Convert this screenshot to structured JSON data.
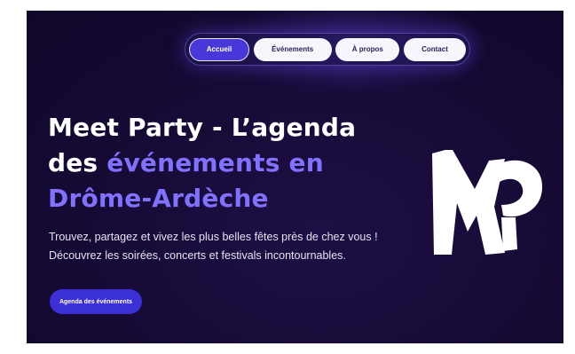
{
  "nav": {
    "items": [
      {
        "label": "Accueil",
        "active": true
      },
      {
        "label": "Événements",
        "active": false
      },
      {
        "label": "À propos",
        "active": false
      },
      {
        "label": "Contact",
        "active": false
      }
    ]
  },
  "hero": {
    "title_line1": "Meet Party - L’agenda",
    "title_line2_prefix": "des ",
    "title_line2_accent": "événements en",
    "title_line3": "Drôme-Ardèche",
    "description": "Trouvez, partagez et vivez les plus belles fêtes près de chez vous ! Découvrez les soirées, concerts et festivals incontournables.",
    "cta_label": "Agenda des événements"
  },
  "logo": {
    "text": "MP",
    "icon": "mp-logo-icon"
  },
  "colors": {
    "background": "#160a35",
    "accent": "#8071ff",
    "button": "#3b2fd6",
    "nav_active": "#4838d8"
  }
}
